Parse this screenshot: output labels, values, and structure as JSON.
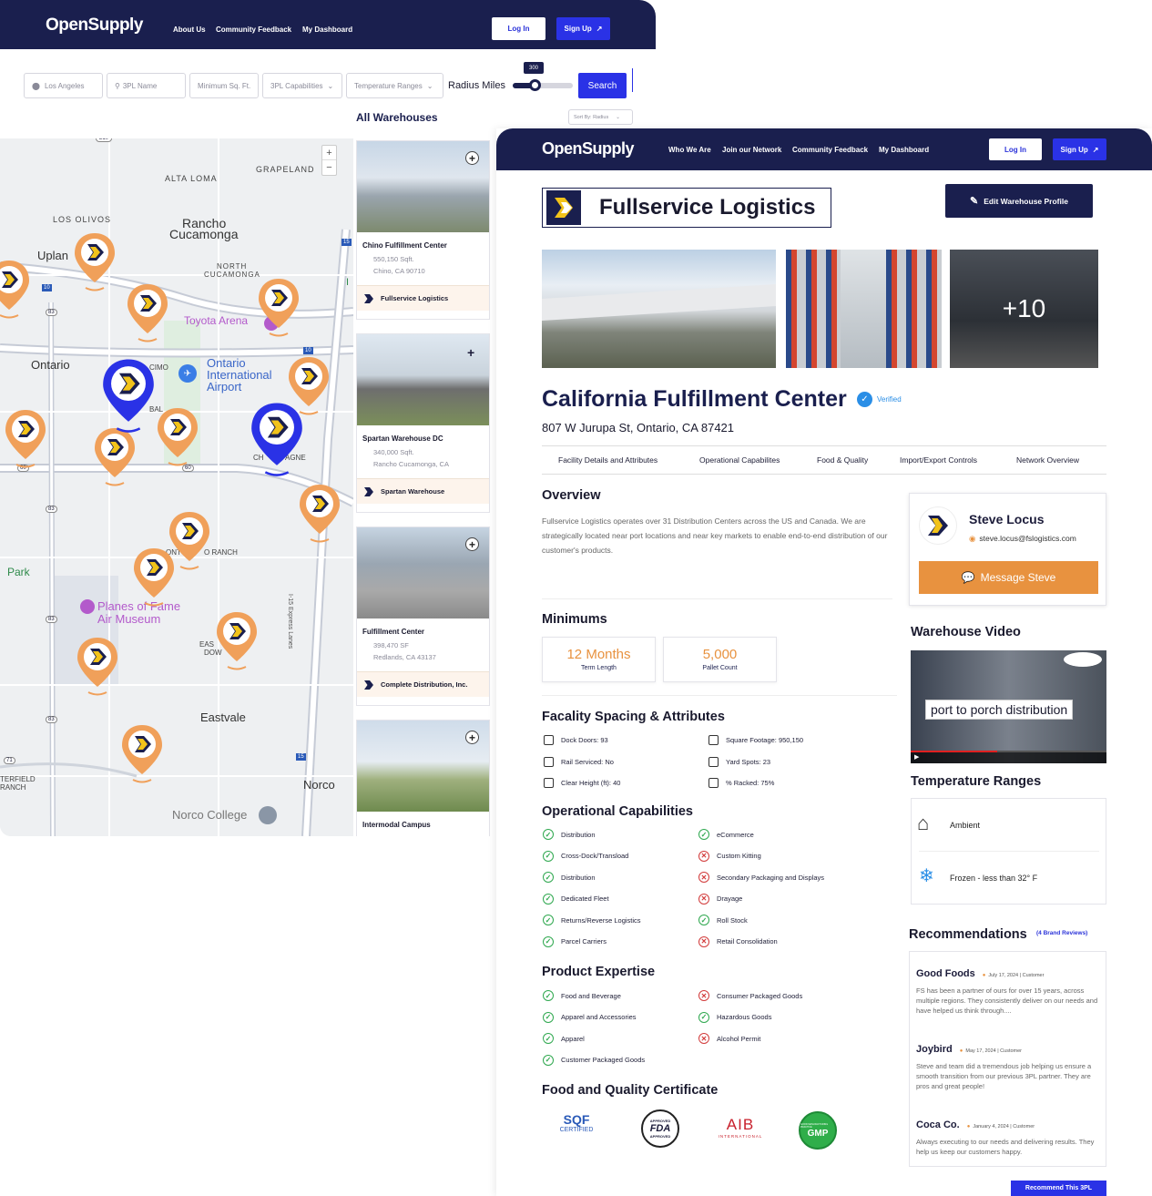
{
  "search_page": {
    "brand": "OpenSupply",
    "nav": [
      "About Us",
      "Community Feedback",
      "My Dashboard"
    ],
    "login_label": "Log In",
    "signup_label": "Sign Up",
    "filters": {
      "location": "Los Angeles",
      "name_placeholder": "3PL Name",
      "min_sqft_placeholder": "Minimum Sq. Ft.",
      "capabilities": "3PL Capabilities",
      "temperature": "Temperature Ranges",
      "radius_label": "Radius Miles",
      "radius_value": "300",
      "radius_fraction": 0.37,
      "search_label": "Search"
    },
    "list_title": "All Warehouses",
    "sort_label": "Sort By: Radius",
    "map_labels": [
      "GRAPELAND",
      "ALTA LOMA",
      "LOS OLIVOS",
      "Rancho",
      "Cucamonga",
      "NORTH",
      "CUCAMONGA",
      "Uplan",
      "Toyota Arena",
      "Ontario",
      "Ontario",
      "International",
      "Airport",
      "CIMO",
      "BAL",
      "CH",
      "AGNE",
      "ONT",
      "O RANCH",
      "Park",
      "Planes of Fame",
      "Air Museum",
      "EAS",
      "DOW",
      "Eastvale",
      "Norco",
      "Norco College",
      "TERFIELD",
      "RANCH",
      "I-15 Express Lanes"
    ],
    "road_shields": [
      "210",
      "15",
      "10",
      "83",
      "10",
      "60",
      "60",
      "83",
      "83",
      "83",
      "71",
      "15",
      "I"
    ],
    "zoom_in": "+",
    "zoom_out": "−",
    "cards": [
      {
        "name": "Chino Fulfillment Center",
        "size": "550,150 Sqft.",
        "location": "Chino, CA 90710",
        "company": "Fullservice Logistics"
      },
      {
        "name": "Spartan Warehouse DC",
        "size": "340,000 Sqft.",
        "location": "Rancho Cucamonga, CA",
        "company": "Spartan Warehouse"
      },
      {
        "name": "Fulfillment Center",
        "size": "398,470 SF",
        "location": "Redlands, CA 43137",
        "company": "Complete Distribution, Inc."
      },
      {
        "name": "Intermodal Campus",
        "size": "",
        "location": "",
        "company": ""
      }
    ]
  },
  "detail_page": {
    "brand": "OpenSupply",
    "nav": [
      "Who We Are",
      "Join our Network",
      "Community Feedback",
      "My Dashboard"
    ],
    "login_label": "Log In",
    "signup_label": "Sign Up",
    "company_name": "Fullservice Logistics",
    "edit_label": "Edit Warehouse Profile",
    "more_photos": "+10",
    "title": "California Fulfillment Center",
    "verified": "Verified",
    "address": "807 W Jurupa St, Ontario, CA 87421",
    "tabs": [
      "Facility Details and Attributes",
      "Operational Capabilites",
      "Food & Quality",
      "Import/Export Controls",
      "Network Overview"
    ],
    "overview_title": "Overview",
    "overview_text": "Fullservice Logistics operates over 31 Distribution Centers across the US and Canada. We are strategically located near port locations and near key markets to enable end-to-end distribution of our customer's products.",
    "contact": {
      "name": "Steve Locus",
      "email": "steve.locus@fslogistics.com",
      "message_label": "Message Steve"
    },
    "minimums_title": "Minimums",
    "minimums": [
      {
        "value": "12 Months",
        "label": "Term Length"
      },
      {
        "value": "5,000",
        "label": "Pallet Count"
      }
    ],
    "spacing_title": "Facality Spacing & Attributes",
    "spacing": [
      "Dock Doors: 93",
      "Square Footage: 950,150",
      "Rail Serviced: No",
      "Yard Spots: 23",
      "Clear Height (ft): 40",
      "% Racked: 75%"
    ],
    "ops_title": "Operational Capabilities",
    "ops": [
      {
        "label": "Distribution",
        "ok": true
      },
      {
        "label": "eCommerce",
        "ok": true
      },
      {
        "label": "Cross-Dock/Transload",
        "ok": true
      },
      {
        "label": "Custom Kitting",
        "ok": false
      },
      {
        "label": "Distribution",
        "ok": true
      },
      {
        "label": "Secondary Packaging and Displays",
        "ok": false
      },
      {
        "label": "Dedicated Fleet",
        "ok": true
      },
      {
        "label": "Drayage",
        "ok": false
      },
      {
        "label": "Returns/Reverse Logistics",
        "ok": true
      },
      {
        "label": "Roll Stock",
        "ok": true
      },
      {
        "label": "Parcel Carriers",
        "ok": true
      },
      {
        "label": "Retail Consolidation",
        "ok": false
      }
    ],
    "product_title": "Product Expertise",
    "products": [
      {
        "label": "Food and Beverage",
        "ok": true
      },
      {
        "label": "Consumer Packaged Goods",
        "ok": false
      },
      {
        "label": "Apparel and Accessories",
        "ok": true
      },
      {
        "label": "Hazardous Goods",
        "ok": true
      },
      {
        "label": "Apparel",
        "ok": true
      },
      {
        "label": "Alcohol Permit",
        "ok": false
      },
      {
        "label": "Customer Packaged Goods",
        "ok": true
      }
    ],
    "cert_title": "Food and Quality Certificate",
    "certs": {
      "sqf": "SQF",
      "sqf_sub": "CERTIFIED",
      "fda_top": "APPROVED",
      "fda": "FDA",
      "fda_bottom": "APPROVED",
      "aib": "AIB",
      "aib_sub": "INTERNATIONAL",
      "gmp": "GMP",
      "gmp_ring": "GOOD MANUFACTURING PRACTICE"
    },
    "video_title": "Warehouse Video",
    "video_caption": "port to porch distribution",
    "temp_title": "Temperature Ranges",
    "temps": [
      "Ambient",
      "Frozen - less than 32° F"
    ],
    "rec_title": "Recommendations",
    "rec_count": "(4 Brand Reviews)",
    "reviews": [
      {
        "name": "Good Foods",
        "meta": "July 17, 2024 | Customer",
        "body": "FS has been a partner of ours for over 15 years, across multiple regions. They consistently deliver on our needs and have helped us think through...."
      },
      {
        "name": "Joybird",
        "meta": "May 17, 2024 | Customer",
        "body": "Steve and team did a tremendous job helping us ensure a smooth transition from our previous 3PL partner. They are pros and great people!"
      },
      {
        "name": "Coca Co.",
        "meta": "January 4, 2024 | Customer",
        "body": "Always executing to our needs and delivering results. They help us keep our customers happy."
      }
    ],
    "recommend_label": "Recommend This 3PL"
  },
  "colors": {
    "navy": "#1a1f4e",
    "blue": "#2a32e6",
    "orange": "#e8923f",
    "pin_orange": "#f0a05a",
    "verified": "#2a8ee6"
  }
}
